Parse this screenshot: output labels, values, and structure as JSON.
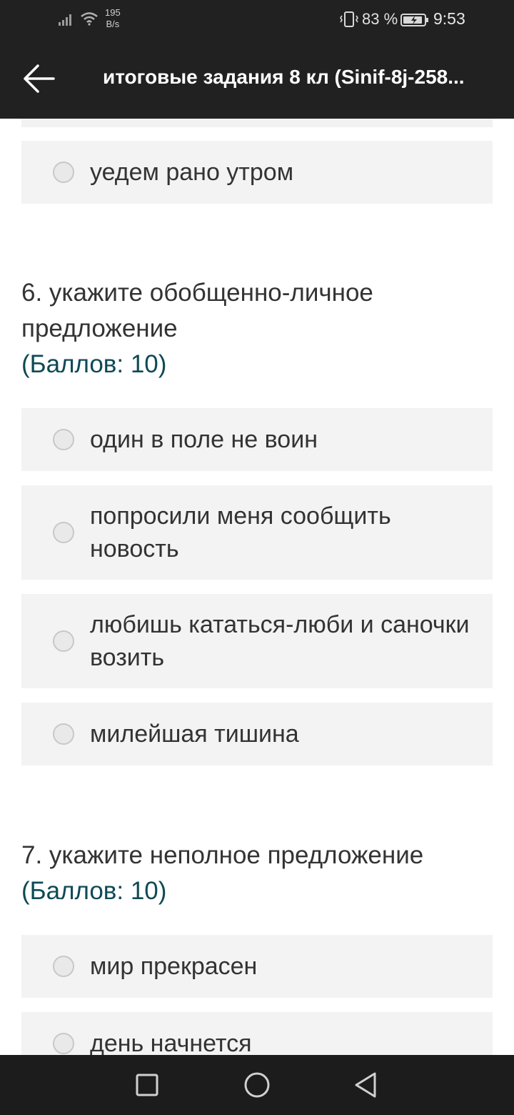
{
  "status_bar": {
    "net_speed_value": "195",
    "net_speed_unit": "B/s",
    "battery_percent": "83 %",
    "time": "9:53",
    "icons": [
      "signal-icon",
      "wifi-icon",
      "vibrate-icon",
      "battery-icon"
    ]
  },
  "app_bar": {
    "title": "итоговые задания 8 кл (Sinif-8j-258...",
    "back_icon": "arrow-left-icon"
  },
  "prev_question": {
    "options": [
      {
        "label": "уедем рано утром"
      }
    ]
  },
  "questions": [
    {
      "title": "6. укажите обобщенно-личное предложение",
      "points": "(Баллов: 10)",
      "options": [
        {
          "label": "один в поле не воин"
        },
        {
          "label": "попросили меня сообщить новость"
        },
        {
          "label": "любишь кататься-люби и саночки возить"
        },
        {
          "label": "милейшая тишина"
        }
      ]
    },
    {
      "title": "7. укажите неполное предложение",
      "points": "(Баллов: 10)",
      "options": [
        {
          "label": "мир прекрасен"
        },
        {
          "label": "день начнется"
        }
      ]
    }
  ],
  "nav_bar": {
    "icons": [
      "square-recent-icon",
      "circle-home-icon",
      "triangle-back-icon"
    ]
  },
  "colors": {
    "app_bar_bg": "#212121",
    "option_bg": "#f3f3f3",
    "points_color": "#0e4a55",
    "nav_bar_bg": "#1c1c1c"
  }
}
